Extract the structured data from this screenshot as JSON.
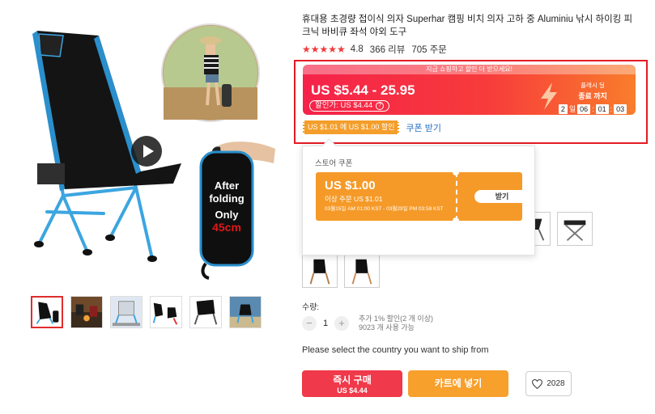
{
  "product": {
    "title": "휴대용 초경량 접이식 의자 Superhar 캠핑 비치 의자 고하 중 Aluminiu 낚시 하이킹 피크닉 바비큐 좌석 야외 도구",
    "rating": "4.8",
    "reviews": "366 리뷰",
    "orders": "705 주문"
  },
  "gallery": {
    "folding_text": [
      "After",
      "folding",
      "Only",
      "45cm"
    ],
    "thumbnail_count": 6
  },
  "price_box": {
    "promo_banner": "지금 쇼핑하고 할인 더 받으세요!",
    "price_range": "US $5.44 - 25.95",
    "discount_label": "할인가: US $4.44",
    "countdown_label": "플래시 딜",
    "countdown_sub": "종료 까지",
    "timer": {
      "days": "2",
      "day_unit": "일",
      "hours": "06",
      "minutes": "01",
      "seconds": "03"
    },
    "coupon_tag": "US $1.01 에 US $1.00 할인",
    "coupon_link": "쿠폰 받기"
  },
  "coupon_popup": {
    "title": "스토어 쿠폰",
    "amount": "US $1.00",
    "condition": "이상 주문 US $1.01",
    "validity": "03월15일 AM 01:00 KST - 03월29일 PM 03:59 KST",
    "button": "받기"
  },
  "quantity": {
    "label": "수량:",
    "minus": "−",
    "value": "1",
    "plus": "+",
    "note_line1": "추가 1% 할인(2 개 이상)",
    "note_line2": "9023 개 사용 가능"
  },
  "shipping": {
    "note": "Please select the country you want to ship from"
  },
  "actions": {
    "buy_now": "즉시 구매",
    "buy_now_price": "US $4.44",
    "add_to_cart": "카트에 넣기",
    "wishlist_count": "2028"
  },
  "colors": {
    "accent_red": "#e31b23",
    "price_gradient_start": "#f5224a",
    "price_gradient_end": "#f97d2c",
    "coupon_orange": "#f59a28",
    "buy_red": "#f0394a",
    "cart_orange": "#f7a02c",
    "link_blue": "#2a71c4",
    "chair_blue": "#3ca5e0"
  }
}
